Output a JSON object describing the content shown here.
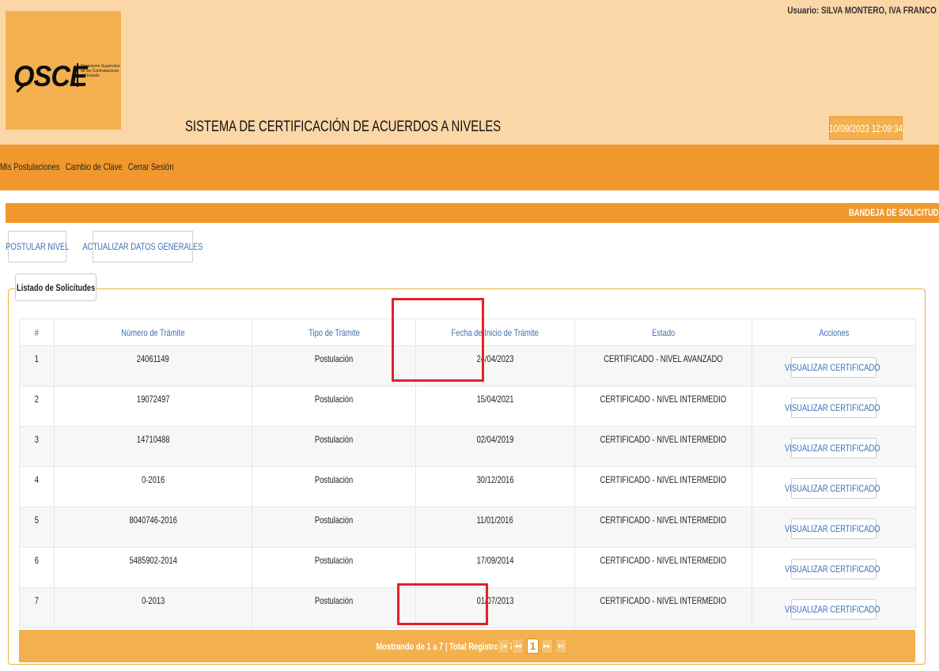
{
  "header": {
    "logo": "OSCE",
    "logo_subtitle": "Organismo Supervisor de las Contrataciones del Estado",
    "user": "Usuario: SILVA MONTERO, IVA FRANCO",
    "system_title": "SISTEMA DE CERTIFICACIÓN DE ACUERDOS A NIVELES",
    "datetime": "10/09/2023 12:09:34"
  },
  "nav": {
    "items": [
      "Mis Postulaciones",
      "Cambio de Clave",
      "Cerrar Sesión"
    ]
  },
  "band": {
    "label": "BANDEJA DE SOLICITUD"
  },
  "buttons": {
    "postular": "POSTULAR NIVEL",
    "actualizar": "ACTUALIZAR DATOS GENERALES"
  },
  "panel": {
    "legend": "Listado de Solicitudes"
  },
  "table": {
    "headers": [
      "#",
      "Número de Trámite",
      "Tipo de Trámite",
      "Fecha de Inicio de Trámite",
      "Estado",
      "Acciones"
    ],
    "rows": [
      {
        "n": "1",
        "numero": "24061149",
        "tipo": "Postulación",
        "fecha": "24/04/2023",
        "estado": "CERTIFICADO - NIVEL AVANZADO",
        "accion": "VISUALIZAR CERTIFICADO"
      },
      {
        "n": "2",
        "numero": "19072497",
        "tipo": "Postulación",
        "fecha": "15/04/2021",
        "estado": "CERTIFICADO - NIVEL INTERMEDIO",
        "accion": "VISUALIZAR CERTIFICADO"
      },
      {
        "n": "3",
        "numero": "14710488",
        "tipo": "Postulación",
        "fecha": "02/04/2019",
        "estado": "CERTIFICADO - NIVEL INTERMEDIO",
        "accion": "VISUALIZAR CERTIFICADO"
      },
      {
        "n": "4",
        "numero": "0-2016",
        "tipo": "Postulación",
        "fecha": "30/12/2016",
        "estado": "CERTIFICADO - NIVEL INTERMEDIO",
        "accion": "VISUALIZAR CERTIFICADO"
      },
      {
        "n": "5",
        "numero": "8040746-2016",
        "tipo": "Postulación",
        "fecha": "11/01/2016",
        "estado": "CERTIFICADO - NIVEL INTERMEDIO",
        "accion": "VISUALIZAR CERTIFICADO"
      },
      {
        "n": "6",
        "numero": "5485902-2014",
        "tipo": "Postulación",
        "fecha": "17/09/2014",
        "estado": "CERTIFICADO - NIVEL INTERMEDIO",
        "accion": "VISUALIZAR CERTIFICADO"
      },
      {
        "n": "7",
        "numero": "0-2013",
        "tipo": "Postulación",
        "fecha": "01/07/2013",
        "estado": "CERTIFICADO - NIVEL INTERMEDIO",
        "accion": "VISUALIZAR CERTIFICADO"
      }
    ]
  },
  "footer": {
    "summary": "Mostrando de 1 a 7 | Total Registros : 7",
    "pager": {
      "first": "|◂",
      "prev": "◂◂",
      "current": "1",
      "next": "▸▸",
      "last": "▸|"
    }
  },
  "icons": {
    "lock": "lock-icon",
    "magnifier": "magnifier-icon"
  },
  "colors": {
    "header_bg": "#fbd7a8",
    "accent_orange": "#f0982e",
    "logo_bg": "#f3b04e",
    "link_blue": "#3d6fb4",
    "highlight_red": "#e5202a"
  }
}
